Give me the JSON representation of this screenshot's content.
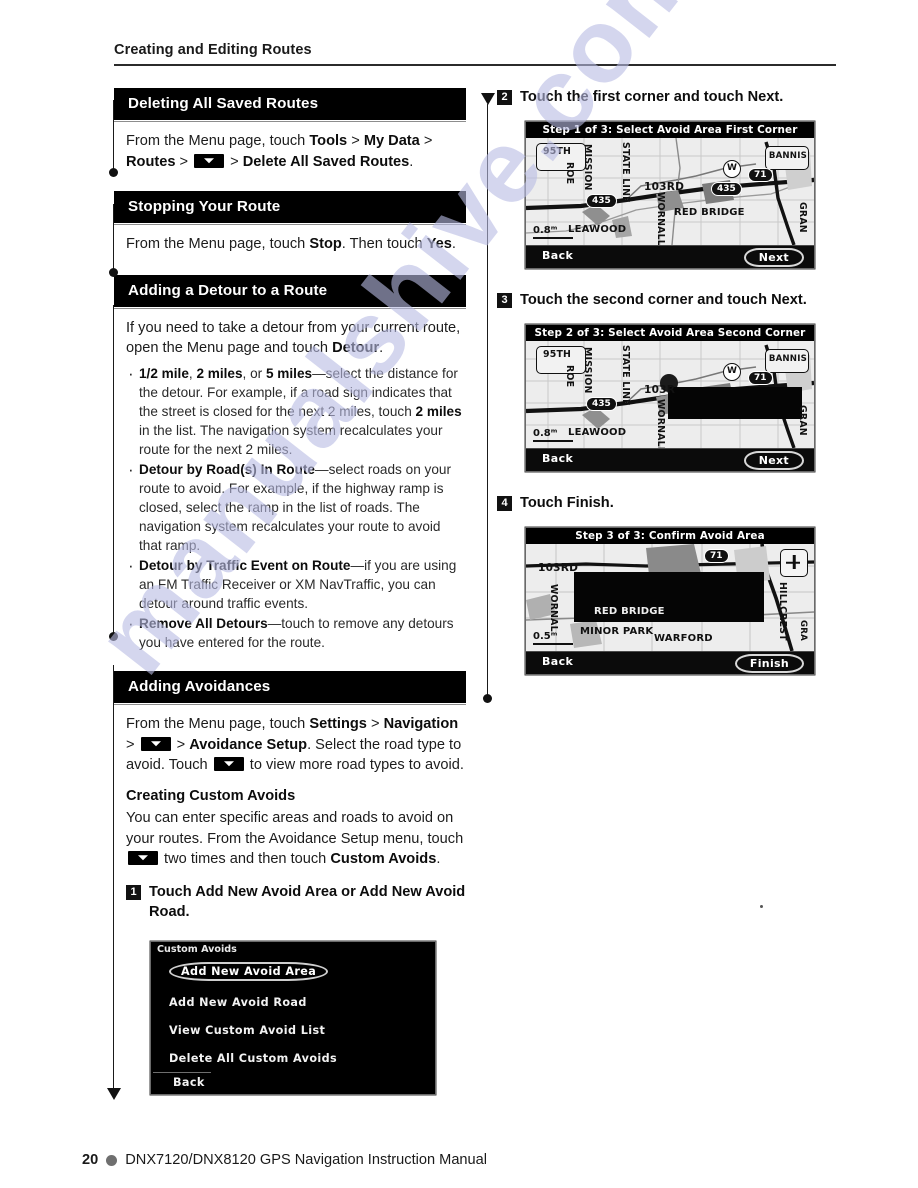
{
  "running_head": "Creating and Editing Routes",
  "watermark": "manualshive.com",
  "footer": {
    "page_number": "20",
    "title": "DNX7120/DNX8120 GPS Navigation Instruction Manual"
  },
  "left_column": {
    "sections": [
      {
        "heading": "Deleting All Saved Routes",
        "paragraph_parts": [
          {
            "t": "From the Menu page, touch ",
            "bold": false
          },
          {
            "t": "Tools",
            "bold": true
          },
          {
            "t": " > ",
            "bold": false
          },
          {
            "t": "My Data",
            "bold": true
          },
          {
            "t": " > ",
            "bold": false
          },
          {
            "t": "Routes",
            "bold": true
          },
          {
            "t": " > ",
            "bold": false
          },
          {
            "t": "CHIP",
            "bold": false
          },
          {
            "t": " > ",
            "bold": false
          },
          {
            "t": "Delete All Saved Routes",
            "bold": true
          },
          {
            "t": ".",
            "bold": false
          }
        ]
      },
      {
        "heading": "Stopping Your Route",
        "paragraph_parts": [
          {
            "t": "From the Menu page, touch ",
            "bold": false
          },
          {
            "t": "Stop",
            "bold": true
          },
          {
            "t": ". Then touch ",
            "bold": false
          },
          {
            "t": "Yes",
            "bold": true
          },
          {
            "t": ".",
            "bold": false
          }
        ]
      },
      {
        "heading": "Adding a Detour to a Route",
        "paragraph_parts": [
          {
            "t": "If you need to take a detour from your current route, open the Menu page and touch ",
            "bold": false
          },
          {
            "t": "Detour",
            "bold": true
          },
          {
            "t": ".",
            "bold": false
          }
        ],
        "bullets": [
          [
            {
              "t": "1/2 mile",
              "bold": true
            },
            {
              "t": ", ",
              "bold": false
            },
            {
              "t": "2 miles",
              "bold": true
            },
            {
              "t": ", or ",
              "bold": false
            },
            {
              "t": "5 miles",
              "bold": true
            },
            {
              "t": "—select the distance for the detour. For example, if a road sign indicates that the street is closed for the next 2 miles, touch ",
              "bold": false
            },
            {
              "t": "2 miles",
              "bold": true
            },
            {
              "t": " in the list. The navigation system recalculates your route for the next 2 miles.",
              "bold": false
            }
          ],
          [
            {
              "t": "Detour by Road(s) In Route",
              "bold": true
            },
            {
              "t": "—select roads on your route to avoid. For example, if the highway ramp is closed, select the ramp in the list of roads. The navigation system recalculates your route to avoid that ramp.",
              "bold": false
            }
          ],
          [
            {
              "t": "Detour by Traffic Event on Route",
              "bold": true
            },
            {
              "t": "—if you are using an FM Traffic Receiver or XM NavTraffic, you can detour around traffic events.",
              "bold": false
            }
          ],
          [
            {
              "t": "Remove All Detours",
              "bold": true
            },
            {
              "t": "—touch to remove any detours you have entered for the route.",
              "bold": false
            }
          ]
        ]
      },
      {
        "heading": "Adding Avoidances",
        "paragraph_parts": [
          {
            "t": "From the Menu page, touch ",
            "bold": false
          },
          {
            "t": "Settings",
            "bold": true
          },
          {
            "t": " > ",
            "bold": false
          },
          {
            "t": "Navigation",
            "bold": true
          },
          {
            "t": " > ",
            "bold": false
          },
          {
            "t": "CHIP",
            "bold": false
          },
          {
            "t": " > ",
            "bold": false
          },
          {
            "t": "Avoidance Setup",
            "bold": true
          },
          {
            "t": ". Select the road type to avoid. Touch ",
            "bold": false
          },
          {
            "t": "CHIP",
            "bold": false
          },
          {
            "t": " to view more road types to avoid.",
            "bold": false
          }
        ],
        "subhead": "Creating Custom Avoids",
        "sub_paragraph_parts": [
          {
            "t": "You can enter specific areas and roads to avoid on your routes. From the Avoidance Setup menu, touch ",
            "bold": false
          },
          {
            "t": "CHIP",
            "bold": false
          },
          {
            "t": " two times and then touch ",
            "bold": false
          },
          {
            "t": "Custom Avoids",
            "bold": true
          },
          {
            "t": ".",
            "bold": false
          }
        ]
      }
    ],
    "step1": {
      "number": "1",
      "text": "Touch Add New Avoid Area or Add New Avoid Road."
    },
    "custom_avoids_screen": {
      "title": "Custom Avoids",
      "items": [
        {
          "label": "Add New Avoid Area",
          "selected": true
        },
        {
          "label": "Add New Avoid Road",
          "selected": false
        },
        {
          "label": "View Custom Avoid List",
          "selected": false
        },
        {
          "label": "Delete All Custom Avoids",
          "selected": false
        }
      ],
      "back_label": "Back"
    }
  },
  "right_column": {
    "steps": [
      {
        "number": "2",
        "text": "Touch the first corner and touch Next.",
        "screen": {
          "title": "Step 1 of 3: Select Avoid Area First Corner",
          "back_label": "Back",
          "action_label": "Next",
          "scale": "0.8ᵐ",
          "labels": [
            "95TH",
            "MISSION",
            "ROE",
            "STATE LINE",
            "103RD",
            "WORNALL",
            "RED BRIDGE",
            "LEAWOOD",
            "GRAN",
            "BANNIS"
          ],
          "shields": [
            "435",
            "435",
            "71"
          ],
          "marker": "W"
        }
      },
      {
        "number": "3",
        "text": "Touch the second corner and touch Next.",
        "screen": {
          "title": "Step 2 of 3: Select Avoid Area Second Corner",
          "back_label": "Back",
          "action_label": "Next",
          "scale": "0.8ᵐ",
          "labels": [
            "95TH",
            "MISSION",
            "ROE",
            "STATE LINE",
            "103R",
            "WORNALL",
            "LEAWOOD",
            "GRAN",
            "BANNIS"
          ],
          "shields": [
            "435",
            "71"
          ],
          "marker": "W"
        }
      },
      {
        "number": "4",
        "text": "Touch Finish.",
        "screen": {
          "title": "Step 3 of 3: Confirm Avoid Area",
          "back_label": "Back",
          "action_label": "Finish",
          "scale": "0.5ᵐ",
          "labels": [
            "103RD",
            "WORNALL",
            "RED BRIDGE",
            "MINOR PARK",
            "WARFORD",
            "HILLCREST",
            "GRA"
          ],
          "shields": [
            "71"
          ],
          "zoom_in_icon": "plus-icon"
        }
      }
    ]
  }
}
